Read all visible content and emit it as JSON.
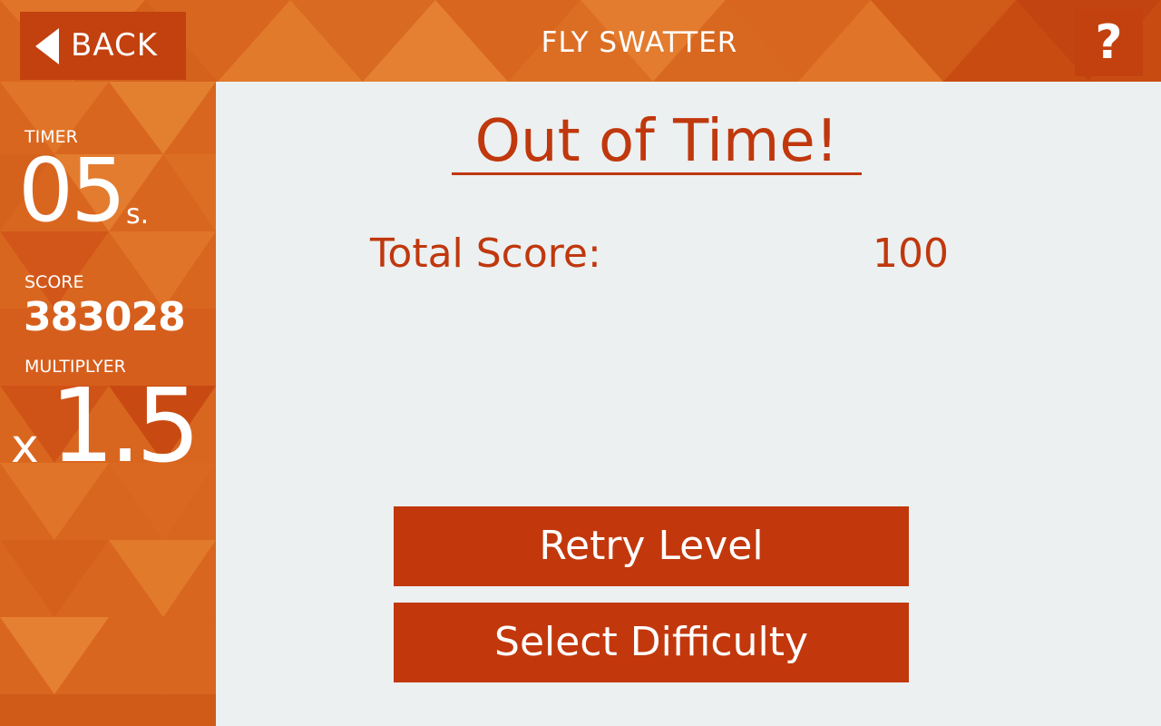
{
  "header": {
    "back_label": "BACK",
    "title": "FLY SWATTER",
    "help_label": "?"
  },
  "stats": {
    "timer_label": "TIMER",
    "timer_value": "05",
    "timer_unit": "s.",
    "score_label": "SCORE",
    "score_value": "383028",
    "multiplier_label": "MULTIPLYER",
    "multiplier_prefix": "x",
    "multiplier_value": "1.5"
  },
  "result": {
    "heading": "Out of Time!",
    "total_score_label": "Total Score:",
    "total_score_value": "100"
  },
  "actions": {
    "retry_label": "Retry Level",
    "select_difficulty_label": "Select Difficulty"
  },
  "colors": {
    "accent": "#c2410f",
    "text_accent": "#c0380d",
    "panel_background": "#ecf0f1",
    "background": "#d9661f"
  },
  "icons": {
    "back": "back-arrow-icon",
    "help": "question-mark-icon"
  }
}
